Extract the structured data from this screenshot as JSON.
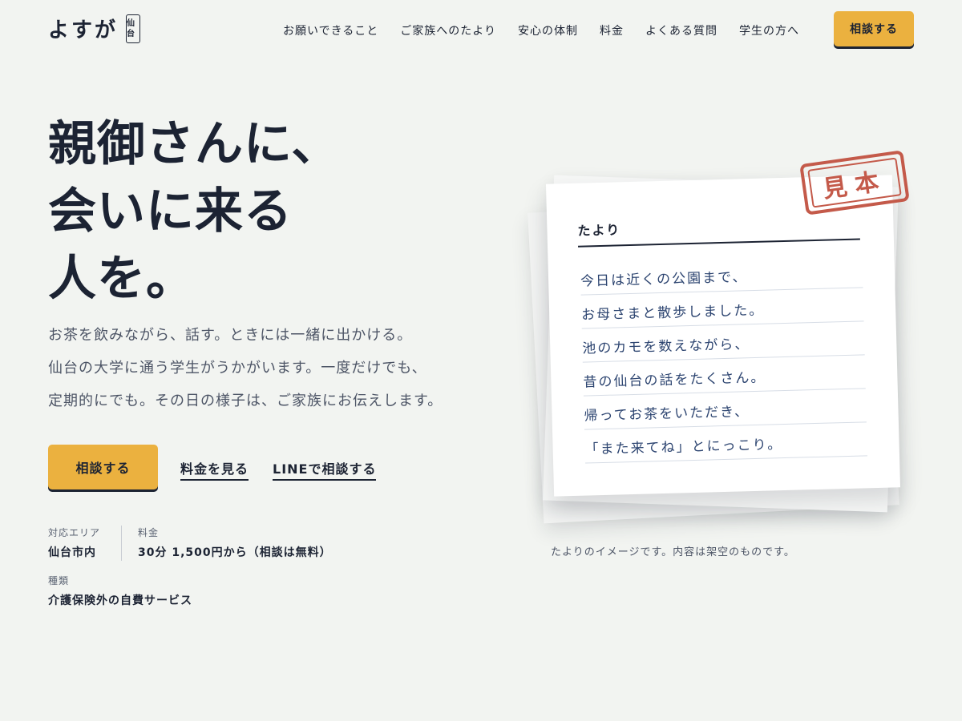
{
  "brand": {
    "name": "よすが",
    "badge": "仙台"
  },
  "nav": {
    "items": [
      "お願いできること",
      "ご家族へのたより",
      "安心の体制",
      "料金",
      "よくある質問",
      "学生の方へ"
    ],
    "cta_label": "相談する"
  },
  "hero": {
    "title_lines": [
      "親御さんに、",
      "会いに来る",
      "人を。"
    ],
    "lead_lines": [
      "お茶を飲みながら、話す。ときには一緒に出かける。",
      "仙台の大学に通う学生がうかがいます。一度だけでも、",
      "定期的にでも。その日の様子は、ご家族にお伝えします。"
    ],
    "cta_primary": "相談する",
    "cta_pricing": "料金を見る",
    "cta_line": "LINEで相談する"
  },
  "meta": {
    "area_label": "対応エリア",
    "area_value": "仙台市内",
    "price_label": "料金",
    "price_value": "30分 1,500円から（相談は無料）",
    "type_label": "種類",
    "type_value": "介護保険外の自費サービス"
  },
  "letter": {
    "stamp": "見本",
    "heading": "たより",
    "lines": [
      "今日は近くの公園まで、",
      "お母さまと散歩しました。",
      "池のカモを数えながら、",
      "昔の仙台の話をたくさん。",
      "帰ってお茶をいただき、",
      "「また来てね」とにっこり。"
    ],
    "caption": "たよりのイメージです。内容は架空のものです。"
  },
  "colors": {
    "background": "#f2f4f1",
    "ink": "#1c2333",
    "accent": "#ebb13f",
    "stamp": "#c45a4a",
    "handwriting": "#2c4470"
  }
}
